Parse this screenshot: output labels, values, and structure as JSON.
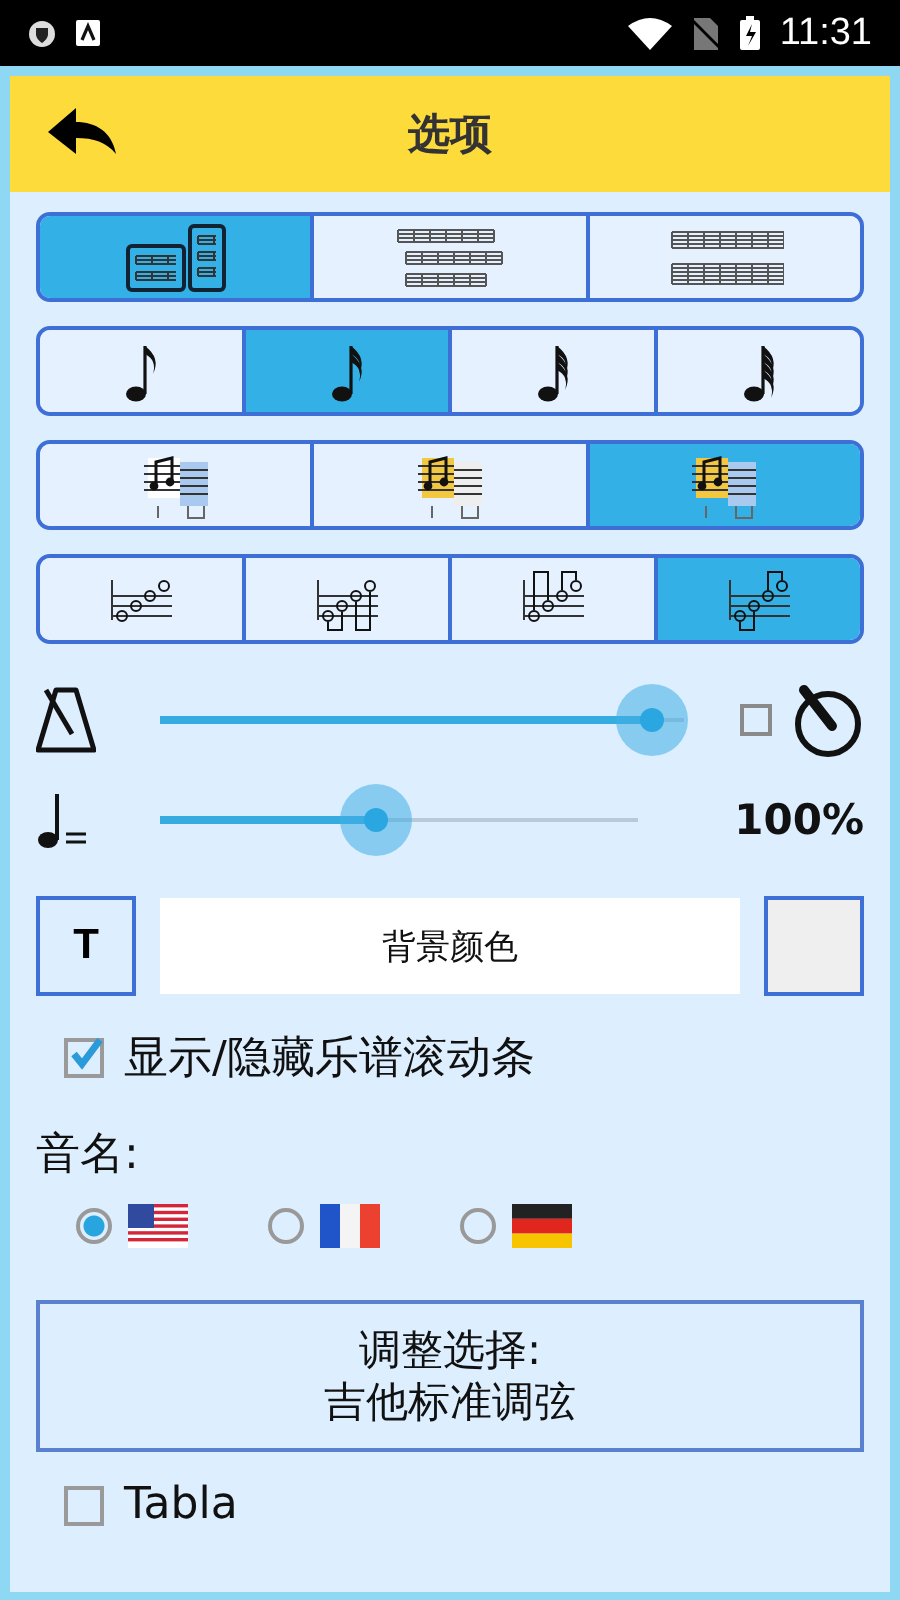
{
  "status_bar": {
    "time": "11:31"
  },
  "header": {
    "title": "选项"
  },
  "segment_rows": [
    {
      "options": [
        {
          "kind": "pages",
          "selected": true
        },
        {
          "kind": "lines-three",
          "selected": false
        },
        {
          "kind": "lines-two",
          "selected": false
        }
      ]
    },
    {
      "options": [
        {
          "kind": "eighth",
          "selected": false
        },
        {
          "kind": "sixteenth",
          "selected": true
        },
        {
          "kind": "thirty-second",
          "selected": false
        },
        {
          "kind": "sixty-fourth",
          "selected": false
        }
      ]
    },
    {
      "options": [
        {
          "kind": "tab-highlight",
          "selected": false
        },
        {
          "kind": "staff-highlight",
          "selected": false
        },
        {
          "kind": "both-highlight",
          "selected": true
        }
      ]
    },
    {
      "options": [
        {
          "kind": "tab-plain",
          "selected": false
        },
        {
          "kind": "tab-stems-down",
          "selected": false
        },
        {
          "kind": "tab-stems-up",
          "selected": false
        },
        {
          "kind": "tab-beamed",
          "selected": true
        }
      ]
    }
  ],
  "tempo_slider": {
    "level": 0.94,
    "timer_checked": false
  },
  "speed_slider": {
    "level": 0.45,
    "reading": "100%"
  },
  "color_row": {
    "text_button": "T",
    "field": "背景颜色"
  },
  "scrollbar_option": {
    "label": "显示/隐藏乐谱滚动条",
    "checked": true
  },
  "note_names": {
    "label": "音名:",
    "options": [
      {
        "kind": "us",
        "selected": true
      },
      {
        "kind": "fr",
        "selected": false
      },
      {
        "kind": "de",
        "selected": false
      }
    ]
  },
  "tuning_button": {
    "lines": [
      "调整选择:",
      "吉他标准调弦"
    ]
  },
  "tab_option": {
    "label": "Tabla",
    "checked": false
  }
}
